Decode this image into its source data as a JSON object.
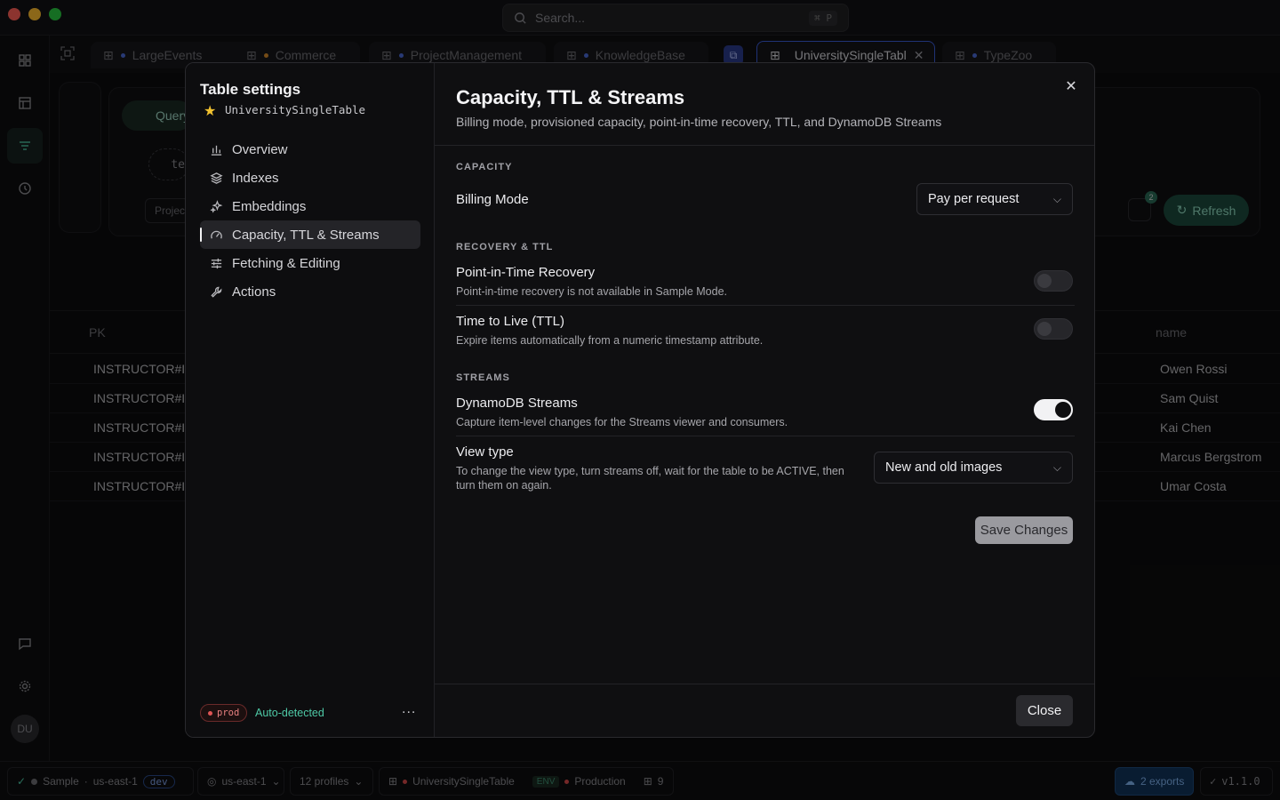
{
  "titlebar": {
    "search_placeholder": "Search...",
    "search_shortcut": "⌘ P"
  },
  "tabs": [
    {
      "label": "LargeEvents",
      "dot_color": "#4a6ad6"
    },
    {
      "label": "Commerce",
      "dot_color": "#d68a2a"
    },
    {
      "label": "ProjectManagement",
      "dot_color": "#4a6ad6"
    },
    {
      "label": "KnowledgeBase",
      "dot_color": "#4a6ad6"
    },
    {
      "label": "UniversitySingleTabl",
      "dot_color": "#d64a4a"
    },
    {
      "label": "TypeZoo",
      "dot_color": "#4a6ad6"
    }
  ],
  "background": {
    "query_label": "Query",
    "filter_text": "te",
    "project_text": "Project",
    "refresh_label": "Refresh",
    "bookmark_count": "2",
    "columns": {
      "pk": "PK",
      "name": "name"
    },
    "rows": [
      {
        "pk": "INSTRUCTOR#IC",
        "name": "Owen Rossi"
      },
      {
        "pk": "INSTRUCTOR#IC",
        "name": "Sam Quist"
      },
      {
        "pk": "INSTRUCTOR#IC",
        "name": "Kai Chen"
      },
      {
        "pk": "INSTRUCTOR#IC",
        "name": "Marcus Bergstrom"
      },
      {
        "pk": "INSTRUCTOR#IC",
        "name": "Umar Costa"
      }
    ]
  },
  "rail": {
    "avatar": "DU"
  },
  "modal": {
    "sidebar": {
      "title": "Table settings",
      "table_name": "UniversitySingleTable",
      "items": [
        {
          "label": "Overview",
          "icon": "bar-chart-icon"
        },
        {
          "label": "Indexes",
          "icon": "layers-icon"
        },
        {
          "label": "Embeddings",
          "icon": "sparkles-icon"
        },
        {
          "label": "Capacity, TTL & Streams",
          "icon": "gauge-icon"
        },
        {
          "label": "Fetching & Editing",
          "icon": "sliders-icon"
        },
        {
          "label": "Actions",
          "icon": "wrench-icon"
        }
      ],
      "env_badge": "prod",
      "env_note": "Auto-detected",
      "more": "..."
    },
    "header": {
      "title": "Capacity, TTL & Streams",
      "subtitle": "Billing mode, provisioned capacity, point-in-time recovery, TTL, and DynamoDB Streams"
    },
    "capacity": {
      "heading": "CAPACITY",
      "billing_label": "Billing Mode",
      "billing_value": "Pay per request"
    },
    "recovery": {
      "heading": "RECOVERY & TTL",
      "pitr_label": "Point-in-Time Recovery",
      "pitr_desc": "Point-in-time recovery is not available in Sample Mode.",
      "pitr_enabled": false,
      "ttl_label": "Time to Live (TTL)",
      "ttl_desc": "Expire items automatically from a numeric timestamp attribute.",
      "ttl_enabled": false
    },
    "streams": {
      "heading": "STREAMS",
      "ddb_label": "DynamoDB Streams",
      "ddb_desc": "Capture item-level changes for the Streams viewer and consumers.",
      "ddb_enabled": true,
      "view_label": "View type",
      "view_desc": "To change the view type, turn streams off, wait for the table to be ACTIVE, then turn them on again.",
      "view_value": "New and old images"
    },
    "save_label": "Save Changes",
    "close_label": "Close"
  },
  "statusbar": {
    "sample": "Sample",
    "region1": "us-east-1",
    "env_tag": "dev",
    "region2": "us-east-1",
    "profiles": "12 profiles",
    "table": "UniversitySingleTable",
    "env_label": "ENV",
    "production": "Production",
    "count": "9",
    "exports": "2 exports",
    "version": "v1.1.0"
  },
  "colors": {
    "accent": "#4ec9a6",
    "tab_active_border": "#3a5bd6",
    "prod_red": "#e05555"
  }
}
